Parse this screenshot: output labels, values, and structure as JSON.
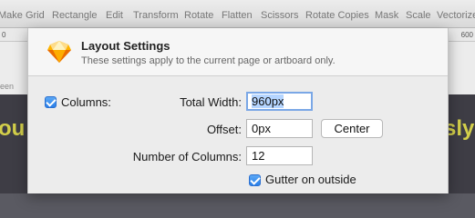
{
  "toolbar": {
    "items": [
      "Make Grid",
      "Rectangle",
      "Edit",
      "Transform",
      "Rotate",
      "Flatten",
      "Scissors",
      "Rotate Copies",
      "Mask",
      "Scale",
      "Vectorize"
    ]
  },
  "ruler": {
    "left_tick": "0",
    "right_tick": "600"
  },
  "background": {
    "left_frag": "ou",
    "right_frag": "sly",
    "left_small": "een"
  },
  "sheet": {
    "title": "Layout Settings",
    "subtitle": "These settings apply to the current page or artboard only.",
    "app_icon": "sketch-diamond-icon"
  },
  "form": {
    "columns_checkbox_label": "Columns:",
    "columns_checked": true,
    "total_width_label": "Total Width:",
    "total_width_value": "960px",
    "offset_label": "Offset:",
    "offset_value": "0px",
    "center_button": "Center",
    "num_columns_label": "Number of Columns:",
    "num_columns_value": "12",
    "gutter_outside_label": "Gutter on outside",
    "gutter_outside_checked": true
  }
}
